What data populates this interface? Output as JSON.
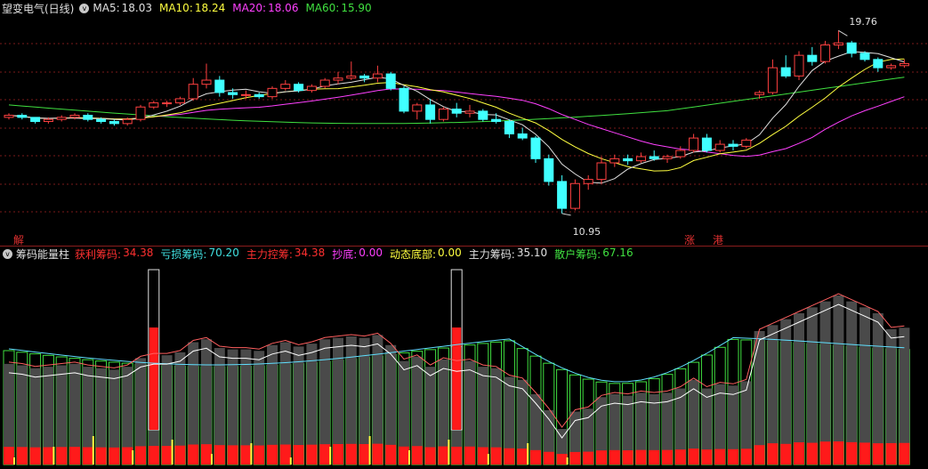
{
  "main": {
    "title": "望变电气(日线)",
    "ma": [
      {
        "label": "MA5:",
        "value": "18.03",
        "color": "#e0e0e0"
      },
      {
        "label": "MA10:",
        "value": "18.24",
        "color": "#ffff40"
      },
      {
        "label": "MA20:",
        "value": "18.06",
        "color": "#ff40ff"
      },
      {
        "label": "MA60:",
        "value": "15.90",
        "color": "#40e040"
      }
    ],
    "high_label": "19.76",
    "low_label": "10.95",
    "markers": [
      "解",
      "涨",
      "港"
    ],
    "colors": {
      "up": "#ff4040",
      "down": "#40ffff",
      "ma5": "#e0e0e0",
      "ma10": "#ffff40",
      "ma20": "#ff40ff",
      "ma60": "#40e040",
      "grid": "#7a1a1a"
    }
  },
  "indicator": {
    "title": "筹码能量柱",
    "items": [
      {
        "label": "获利筹码:",
        "value": "34.38",
        "color": "#ff3030"
      },
      {
        "label": "亏损筹码:",
        "value": "70.20",
        "color": "#40e0e0"
      },
      {
        "label": "主力控筹:",
        "value": "34.38",
        "color": "#ff3030"
      },
      {
        "label": "抄底:",
        "value": "0.00",
        "color": "#ff40ff"
      },
      {
        "label": "动态底部:",
        "value": "0.00",
        "color": "#ffff40"
      },
      {
        "label": "主力筹码:",
        "value": "35.10",
        "color": "#e0e0e0"
      },
      {
        "label": "散户筹码:",
        "value": "67.16",
        "color": "#40e040"
      }
    ]
  },
  "chart_data": {
    "type": "candlestick",
    "x_count": 69,
    "candles": [
      [
        15.6,
        15.8,
        15.5,
        15.7
      ],
      [
        15.7,
        15.8,
        15.5,
        15.6
      ],
      [
        15.6,
        15.6,
        15.3,
        15.4
      ],
      [
        15.4,
        15.6,
        15.3,
        15.5
      ],
      [
        15.5,
        15.7,
        15.4,
        15.6
      ],
      [
        15.6,
        15.8,
        15.5,
        15.7
      ],
      [
        15.7,
        15.8,
        15.4,
        15.5
      ],
      [
        15.5,
        15.6,
        15.3,
        15.4
      ],
      [
        15.4,
        15.5,
        15.2,
        15.3
      ],
      [
        15.3,
        15.6,
        15.2,
        15.5
      ],
      [
        15.5,
        16.2,
        15.4,
        16.1
      ],
      [
        16.1,
        16.4,
        16.0,
        16.3
      ],
      [
        16.3,
        16.4,
        16.1,
        16.3
      ],
      [
        16.3,
        16.6,
        16.2,
        16.5
      ],
      [
        16.5,
        17.5,
        16.4,
        17.2
      ],
      [
        17.2,
        18.2,
        17.0,
        17.4
      ],
      [
        17.4,
        17.6,
        16.6,
        16.8
      ],
      [
        16.8,
        17.0,
        16.5,
        16.7
      ],
      [
        16.7,
        16.9,
        16.5,
        16.7
      ],
      [
        16.7,
        16.8,
        16.5,
        16.6
      ],
      [
        16.6,
        17.1,
        16.5,
        17.0
      ],
      [
        17.0,
        17.4,
        16.9,
        17.2
      ],
      [
        17.2,
        17.3,
        16.8,
        16.9
      ],
      [
        16.9,
        17.2,
        16.8,
        17.1
      ],
      [
        17.1,
        17.5,
        17.0,
        17.4
      ],
      [
        17.4,
        17.8,
        17.2,
        17.5
      ],
      [
        17.5,
        18.3,
        17.4,
        17.6
      ],
      [
        17.6,
        17.7,
        17.3,
        17.5
      ],
      [
        17.5,
        18.1,
        17.3,
        17.7
      ],
      [
        17.7,
        17.8,
        16.9,
        17.0
      ],
      [
        17.0,
        17.1,
        15.8,
        15.9
      ],
      [
        15.9,
        16.3,
        15.5,
        16.2
      ],
      [
        16.2,
        16.5,
        15.3,
        15.5
      ],
      [
        15.5,
        16.1,
        15.4,
        16.0
      ],
      [
        16.0,
        16.3,
        15.6,
        15.8
      ],
      [
        15.8,
        16.2,
        15.6,
        15.9
      ],
      [
        15.9,
        16.0,
        15.4,
        15.5
      ],
      [
        15.5,
        15.8,
        15.3,
        15.4
      ],
      [
        15.4,
        15.5,
        14.6,
        14.8
      ],
      [
        14.8,
        15.1,
        14.5,
        14.6
      ],
      [
        14.6,
        14.7,
        13.4,
        13.6
      ],
      [
        13.6,
        13.8,
        12.3,
        12.5
      ],
      [
        12.5,
        12.8,
        10.95,
        11.2
      ],
      [
        11.2,
        12.6,
        11.1,
        12.4
      ],
      [
        12.4,
        12.8,
        12.1,
        12.6
      ],
      [
        12.6,
        13.7,
        12.4,
        13.4
      ],
      [
        13.4,
        13.8,
        13.2,
        13.6
      ],
      [
        13.6,
        13.8,
        13.3,
        13.5
      ],
      [
        13.5,
        13.9,
        13.4,
        13.7
      ],
      [
        13.7,
        14.0,
        13.5,
        13.6
      ],
      [
        13.6,
        13.8,
        13.4,
        13.7
      ],
      [
        13.7,
        14.2,
        13.6,
        14.0
      ],
      [
        14.0,
        14.8,
        13.9,
        14.6
      ],
      [
        14.6,
        14.8,
        13.9,
        14.0
      ],
      [
        14.0,
        14.5,
        13.9,
        14.3
      ],
      [
        14.3,
        14.5,
        14.0,
        14.2
      ],
      [
        14.2,
        14.6,
        14.1,
        14.5
      ],
      [
        16.7,
        16.9,
        16.5,
        16.8
      ],
      [
        16.8,
        18.4,
        16.7,
        18.0
      ],
      [
        18.0,
        18.6,
        17.5,
        17.6
      ],
      [
        17.6,
        18.8,
        17.4,
        18.6
      ],
      [
        18.6,
        19.0,
        18.1,
        18.3
      ],
      [
        18.3,
        19.3,
        18.2,
        19.1
      ],
      [
        19.1,
        19.8,
        18.9,
        19.2
      ],
      [
        19.2,
        19.3,
        18.5,
        18.7
      ],
      [
        18.7,
        18.8,
        18.3,
        18.4
      ],
      [
        18.4,
        18.5,
        17.8,
        18.0
      ],
      [
        18.0,
        18.2,
        17.9,
        18.1
      ],
      [
        18.1,
        18.4,
        18.0,
        18.2
      ]
    ]
  }
}
